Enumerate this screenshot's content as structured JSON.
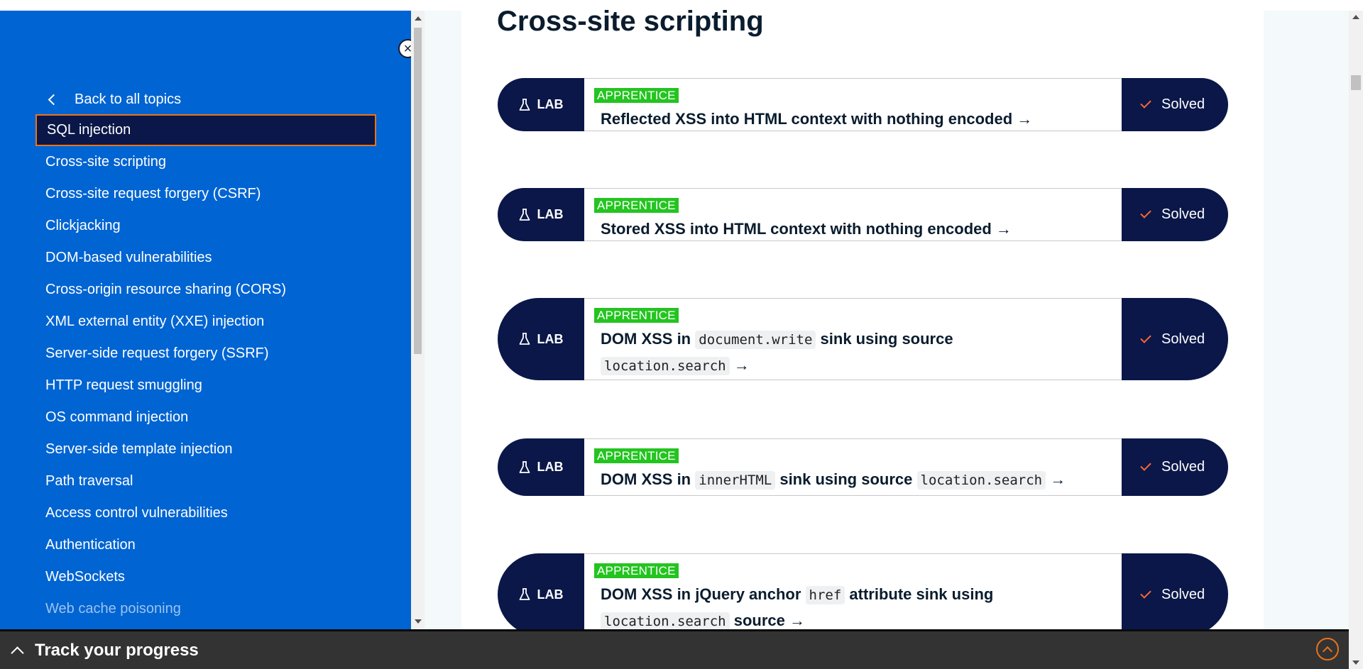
{
  "sidebar": {
    "close_icon": "×",
    "back_label": "Back to all topics",
    "items": [
      {
        "label": "SQL injection"
      },
      {
        "label": "Cross-site scripting"
      },
      {
        "label": "Cross-site request forgery (CSRF)"
      },
      {
        "label": "Clickjacking"
      },
      {
        "label": "DOM-based vulnerabilities"
      },
      {
        "label": "Cross-origin resource sharing (CORS)"
      },
      {
        "label": "XML external entity (XXE) injection"
      },
      {
        "label": "Server-side request forgery (SSRF)"
      },
      {
        "label": "HTTP request smuggling"
      },
      {
        "label": "OS command injection"
      },
      {
        "label": "Server-side template injection"
      },
      {
        "label": "Path traversal"
      },
      {
        "label": "Access control vulnerabilities"
      },
      {
        "label": "Authentication"
      },
      {
        "label": "WebSockets"
      },
      {
        "label": "Web cache poisoning"
      }
    ]
  },
  "main": {
    "title": "Cross-site scripting",
    "labs": [
      {
        "tag": "LAB",
        "level": "APPRENTICE",
        "status": "Solved",
        "parts": [
          "Reflected XSS into HTML context with nothing encoded →"
        ]
      },
      {
        "tag": "LAB",
        "level": "APPRENTICE",
        "status": "Solved",
        "parts": [
          "Stored XSS into HTML context with nothing encoded →"
        ]
      },
      {
        "tag": "LAB",
        "level": "APPRENTICE",
        "status": "Solved",
        "parts": [
          "DOM XSS in",
          "document.write",
          "sink using source",
          "location.search",
          "→"
        ]
      },
      {
        "tag": "LAB",
        "level": "APPRENTICE",
        "status": "Solved",
        "parts": [
          "DOM XSS in",
          "innerHTML",
          "sink using source",
          "location.search",
          "→"
        ]
      },
      {
        "tag": "LAB",
        "level": "APPRENTICE",
        "status": "Solved",
        "parts": [
          "DOM XSS in jQuery anchor",
          "href",
          "attribute sink using",
          "location.search",
          "source →"
        ]
      }
    ]
  },
  "footer": {
    "progress_label": "Track your progress"
  },
  "colors": {
    "sidebar_bg": "#0064d2",
    "navy": "#0a1748",
    "accent_orange": "#e8731c",
    "badge_green": "#24c420"
  }
}
